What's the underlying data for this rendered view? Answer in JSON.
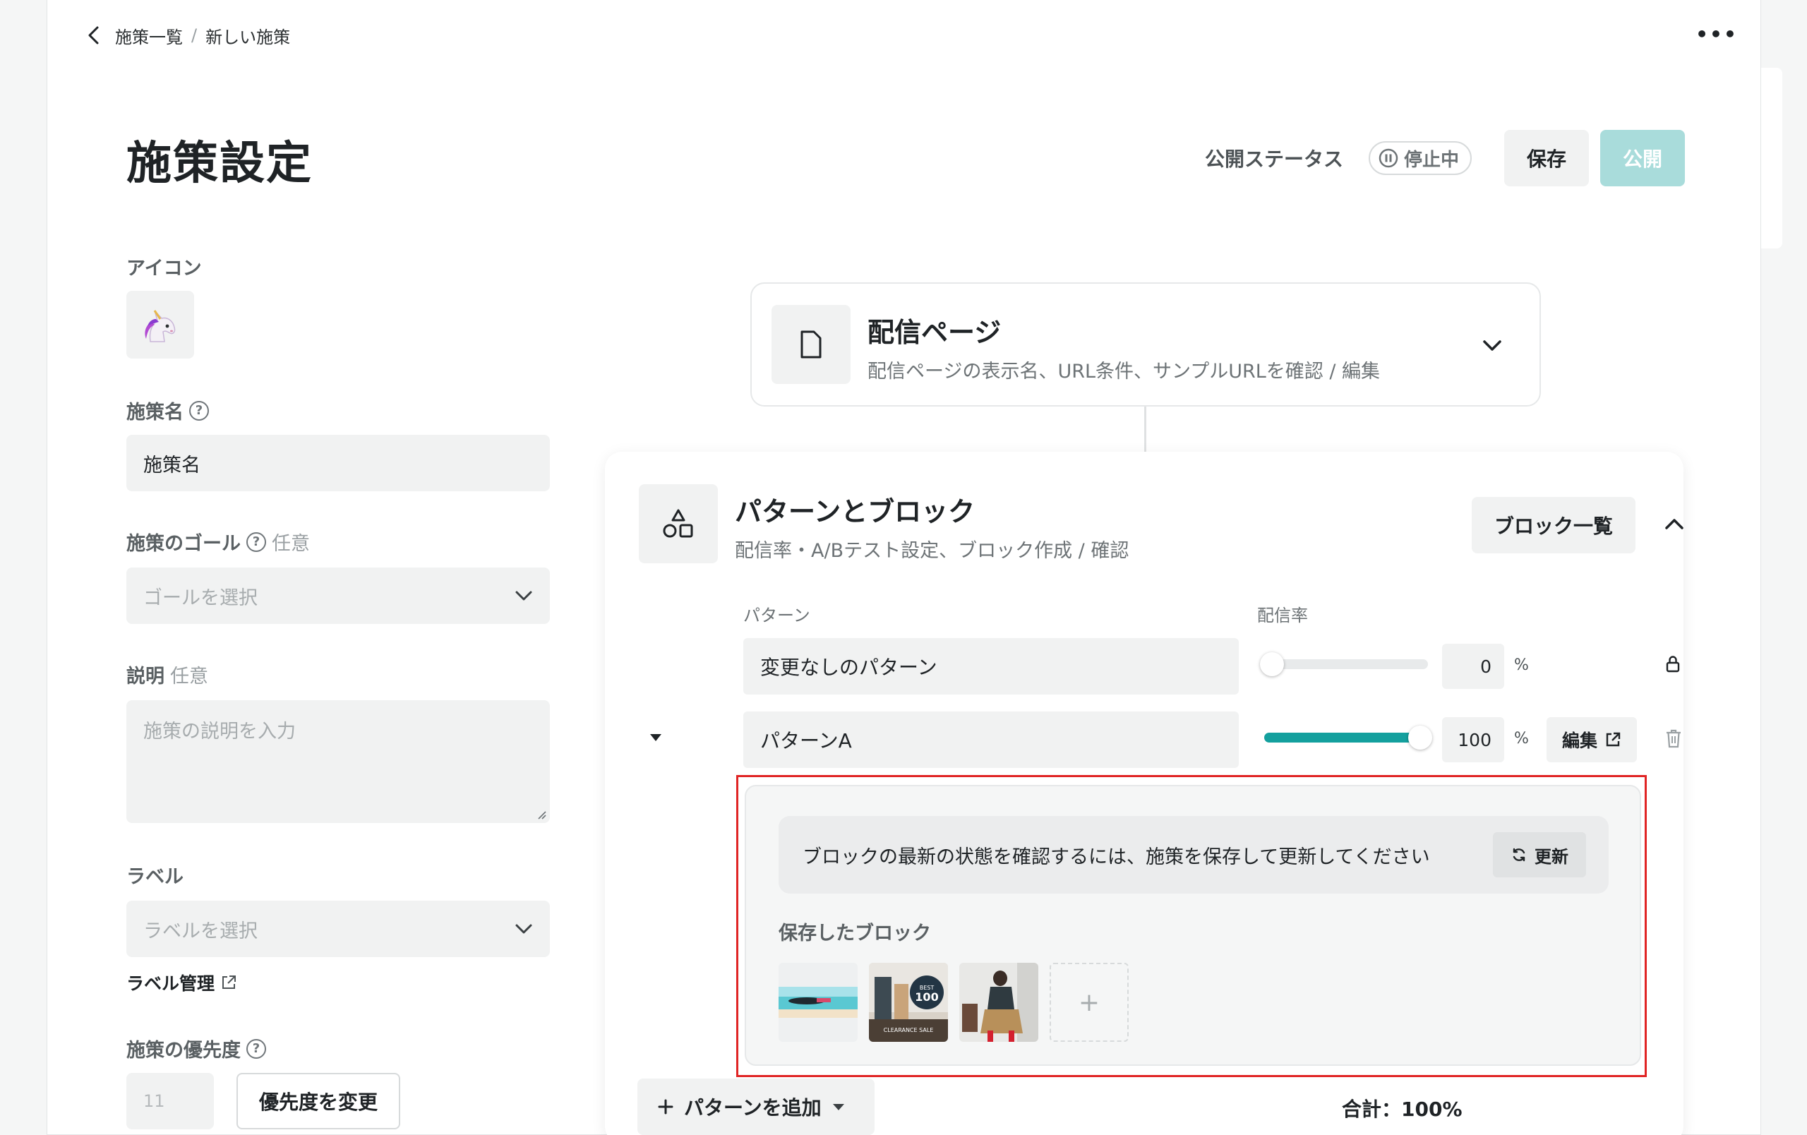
{
  "breadcrumb": {
    "parent": "施策一覧",
    "separator": "/",
    "current": "新しい施策"
  },
  "page": {
    "title": "施策設定"
  },
  "header": {
    "status_label": "公開ステータス",
    "status_value": "停止中",
    "save_label": "保存",
    "publish_label": "公開"
  },
  "form": {
    "icon_label": "アイコン",
    "icon_emoji": "🦄",
    "name_label": "施策名",
    "name_value": "施策名",
    "goal_label": "施策のゴール",
    "goal_optional": "任意",
    "goal_placeholder": "ゴールを選択",
    "description_label": "説明",
    "description_optional": "任意",
    "description_placeholder": "施策の説明を入力",
    "labels_label": "ラベル",
    "labels_placeholder": "ラベルを選択",
    "label_management": "ラベル管理",
    "priority_label": "施策の優先度",
    "priority_value": "11",
    "priority_button": "優先度を変更"
  },
  "delivery": {
    "title": "配信ページ",
    "subtitle": "配信ページの表示名、URL条件、サンプルURLを確認 / 編集"
  },
  "patterns": {
    "title": "パターンとブロック",
    "subtitle": "配信率・A/Bテスト設定、ブロック作成 / 確認",
    "block_list_label": "ブロック一覧",
    "col_pattern": "パターン",
    "col_rate": "配信率",
    "rows": [
      {
        "name": "変更なしのパターン",
        "rate": "0",
        "rate_fraction": 0.0,
        "unit": "%"
      },
      {
        "name": "パターンA",
        "rate": "100",
        "rate_fraction": 1.0,
        "unit": "%",
        "edit_label": "編集"
      }
    ],
    "notice": "ブロックの最新の状態を確認するには、施策を保存して更新してください",
    "refresh_label": "更新",
    "saved_blocks_label": "保存したブロック",
    "thumb2_text_top": "BEST",
    "thumb2_text_num": "100",
    "thumb2_text_bottom": "CLEARANCE SALE",
    "add_block": "+",
    "add_pattern_label": "パターンを追加",
    "total_label": "合計：100%"
  },
  "colors": {
    "accent": "#14a09e",
    "publish_disabled": "#a9dcdb",
    "highlight": "#e02424"
  }
}
